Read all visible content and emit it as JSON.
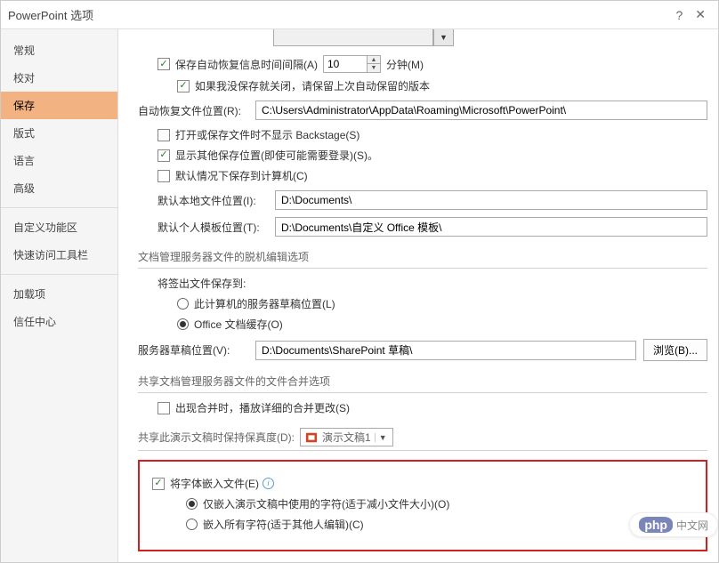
{
  "window": {
    "title": "PowerPoint 选项",
    "help": "?",
    "close_aria": "关闭"
  },
  "sidebar": {
    "items": [
      {
        "label": "常规"
      },
      {
        "label": "校对"
      },
      {
        "label": "保存",
        "selected": true
      },
      {
        "label": "版式"
      },
      {
        "label": "语言"
      },
      {
        "label": "高级"
      }
    ],
    "items2": [
      {
        "label": "自定义功能区"
      },
      {
        "label": "快速访问工具栏"
      }
    ],
    "items3": [
      {
        "label": "加载项"
      },
      {
        "label": "信任中心"
      }
    ]
  },
  "save_section": {
    "autosave_label": "保存自动恢复信息时间间隔(A)",
    "autosave_value": "10",
    "autosave_unit": "分钟(M)",
    "keep_last_label": "如果我没保存就关闭，请保留上次自动保留的版本",
    "autorecover_loc_label": "自动恢复文件位置(R):",
    "autorecover_loc_value": "C:\\Users\\Administrator\\AppData\\Roaming\\Microsoft\\PowerPoint\\",
    "hide_backstage_label": "打开或保存文件时不显示 Backstage(S)",
    "show_other_loc_label": "显示其他保存位置(即使可能需要登录)(S)。",
    "default_computer_label": "默认情况下保存到计算机(C)",
    "default_local_label": "默认本地文件位置(I):",
    "default_local_value": "D:\\Documents\\",
    "default_template_label": "默认个人模板位置(T):",
    "default_template_value": "D:\\Documents\\自定义 Office 模板\\"
  },
  "offline_section": {
    "header": "文档管理服务器文件的脱机编辑选项",
    "checkout_label": "将签出文件保存到:",
    "radio_server_drafts": "此计算机的服务器草稿位置(L)",
    "radio_office_cache": "Office 文档缓存(O)",
    "server_drafts_label": "服务器草稿位置(V):",
    "server_drafts_value": "D:\\Documents\\SharePoint 草稿\\",
    "browse_button": "浏览(B)..."
  },
  "merge_section": {
    "header": "共享文档管理服务器文件的文件合并选项",
    "detail_merge_label": "出现合并时，播放详细的合并更改(S)"
  },
  "fidelity_section": {
    "header": "共享此演示文稿时保持保真度(D):",
    "dropdown_value": "演示文稿1",
    "embed_fonts_label": "将字体嵌入文件(E)",
    "radio_subset": "仅嵌入演示文稿中使用的字符(适于减小文件大小)(O)",
    "radio_all": "嵌入所有字符(适于其他人编辑)(C)"
  },
  "watermark": {
    "text": "中文网"
  }
}
